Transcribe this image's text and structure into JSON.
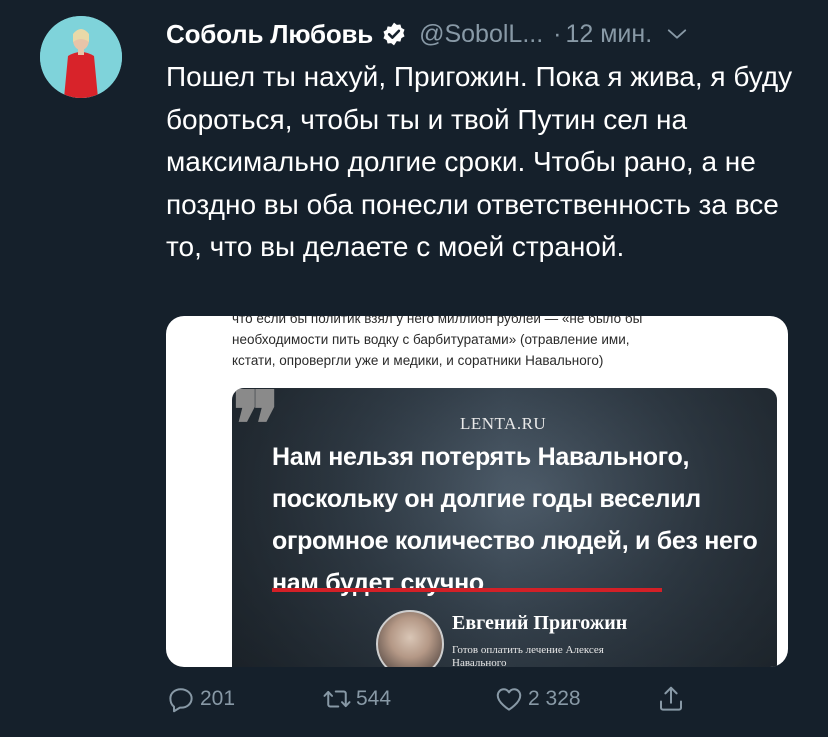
{
  "author": {
    "name": "Соболь Любовь",
    "handle": "@SobolL...",
    "time": "12 мин."
  },
  "tweet": {
    "text": "Пошел ты нахуй, Пригожин. Пока я жива, я буду бороться, чтобы ты и твой Путин сел на максимально долгие сроки. Чтобы рано, а не поздно вы оба понесли ответственность за все то, что вы делаете с моей страной."
  },
  "media": {
    "article_lines": [
      "что если бы политик взял у него миллион рублей — «не было бы",
      "необходимости пить водку с барбитуратами» (отравление ими,",
      "кстати, опровергли уже и медики, и соратники Навального)"
    ],
    "card": {
      "brand": "LENTA.RU",
      "headline": "Нам нельзя потерять Навального, поскольку он долгие годы веселил огромное количество людей, и без него нам будет скучно",
      "person_name": "Евгений Пригожин",
      "person_caption": "Готов оплатить лечение Алексея Навального"
    }
  },
  "actions": {
    "replies": "201",
    "retweets": "544",
    "likes": "2 328"
  },
  "icons": {
    "verified": "verified-badge-icon",
    "menu": "chevron-down-icon",
    "reply": "reply-icon",
    "retweet": "retweet-icon",
    "like": "heart-icon",
    "share": "share-icon"
  },
  "colors": {
    "background": "#15202b",
    "secondary_text": "#8899a6",
    "primary_text": "#ffffff",
    "accent_red": "#d32027"
  }
}
